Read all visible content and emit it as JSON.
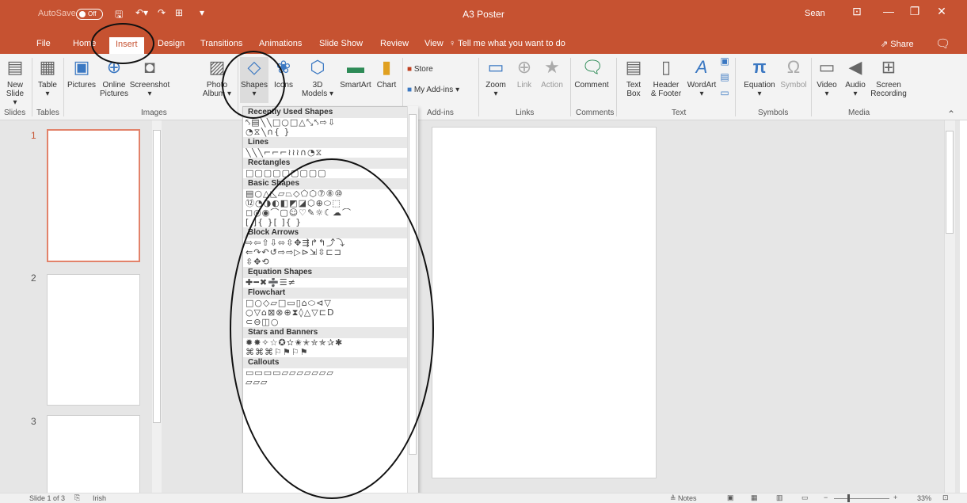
{
  "app": {
    "title": "A3 Poster",
    "user": "Sean",
    "autosave": "AutoSave",
    "autosave_state": "Off"
  },
  "tabs": [
    "File",
    "Home",
    "Insert",
    "Design",
    "Transitions",
    "Animations",
    "Slide Show",
    "Review",
    "View"
  ],
  "tellme": "Tell me what you want to do",
  "share": "Share",
  "ribbon": {
    "buttons": [
      {
        "l1": "New",
        "l2": "Slide ▾",
        "icon": "new-slide-icon"
      },
      {
        "l1": "Table",
        "l2": "▾",
        "icon": "table-icon"
      },
      {
        "l1": "Pictures",
        "l2": "",
        "icon": "pictures-icon"
      },
      {
        "l1": "Online",
        "l2": "Pictures",
        "icon": "online-pictures-icon"
      },
      {
        "l1": "Screenshot",
        "l2": "▾",
        "icon": "screenshot-icon"
      },
      {
        "l1": "Photo",
        "l2": "Album ▾",
        "icon": "photo-album-icon"
      },
      {
        "l1": "Shapes",
        "l2": "▾",
        "icon": "shapes-icon"
      },
      {
        "l1": "Icons",
        "l2": "",
        "icon": "icons-icon"
      },
      {
        "l1": "3D",
        "l2": "Models ▾",
        "icon": "3d-models-icon"
      },
      {
        "l1": "SmartArt",
        "l2": "",
        "icon": "smartart-icon"
      },
      {
        "l1": "Chart",
        "l2": "",
        "icon": "chart-icon"
      },
      {
        "l1": "Zoom",
        "l2": "▾",
        "icon": "zoom-icon"
      },
      {
        "l1": "Link",
        "l2": "",
        "icon": "link-icon"
      },
      {
        "l1": "Action",
        "l2": "",
        "icon": "action-icon"
      },
      {
        "l1": "Comment",
        "l2": "",
        "icon": "comment-icon"
      },
      {
        "l1": "Text",
        "l2": "Box",
        "icon": "textbox-icon"
      },
      {
        "l1": "Header",
        "l2": "& Footer",
        "icon": "header-footer-icon"
      },
      {
        "l1": "WordArt",
        "l2": "▾",
        "icon": "wordart-icon"
      },
      {
        "l1": "Equation",
        "l2": "▾",
        "icon": "equation-icon"
      },
      {
        "l1": "Symbol",
        "l2": "",
        "icon": "symbol-icon"
      },
      {
        "l1": "Video",
        "l2": "▾",
        "icon": "video-icon"
      },
      {
        "l1": "Audio",
        "l2": "▾",
        "icon": "audio-icon"
      },
      {
        "l1": "Screen",
        "l2": "Recording",
        "icon": "screen-recording-icon"
      }
    ],
    "store": "Store",
    "addins": "My Add-ins",
    "groups": [
      "Slides",
      "Tables",
      "Images",
      "Add-ins",
      "Links",
      "Comments",
      "Text",
      "Symbols",
      "Media"
    ]
  },
  "gallery": {
    "sections": [
      {
        "title": "Recently Used Shapes",
        "rows": [
          "⤣▤╲╲□○□△⤡⤣⇨⇩",
          "◔⧖╲∩{ }"
        ]
      },
      {
        "title": "Lines",
        "rows": [
          "╲╲╲⌐⌐⌐≀≀≀∩◔⧖"
        ]
      },
      {
        "title": "Rectangles",
        "rows": [
          "□▢▢▢▢▢▢▢▢"
        ]
      },
      {
        "title": "Basic Shapes",
        "rows": [
          "▤○△◺▱⏢◇⬠⬡⑦⑧⑩",
          "⑫◔◑◐◧◩◪⬡⊕⬭⬚",
          "◻◎◉⌒▢☺♡✎☼☾☁⌒",
          "[ ]{ }[ ]{ }"
        ]
      },
      {
        "title": "Block Arrows",
        "rows": [
          "⇨⇦⇧⇩⬄⇳✥⇶↱↰⤴⤵",
          "⇐↷↶↺⇨⇨▷⊳⇲⇳⊏⊐",
          "⇳✥⟲"
        ]
      },
      {
        "title": "Equation Shapes",
        "rows": [
          "✚━✖➗☰≠"
        ]
      },
      {
        "title": "Flowchart",
        "rows": [
          "□○◇▱□▭▯⌂⬭⊲▽",
          "○▽⌂⊠⊗⊕⧗◊△▽⊏D",
          "⊂⊖◫○"
        ]
      },
      {
        "title": "Stars and Banners",
        "rows": [
          "✹✸✧☆✪✫✬✭✮✯✰✱",
          "⌘⌘⌘⚐⚑⚐⚑"
        ]
      },
      {
        "title": "Callouts",
        "rows": [
          "▭▭▭▭▱▱▱▱▱▱▱",
          "▱▱▱"
        ]
      }
    ]
  },
  "slides": {
    "numbers": [
      "1",
      "2",
      "3"
    ]
  },
  "status": {
    "slide": "Slide 1 of 3",
    "language": "Irish",
    "notes": "Notes",
    "zoom": "33%"
  }
}
